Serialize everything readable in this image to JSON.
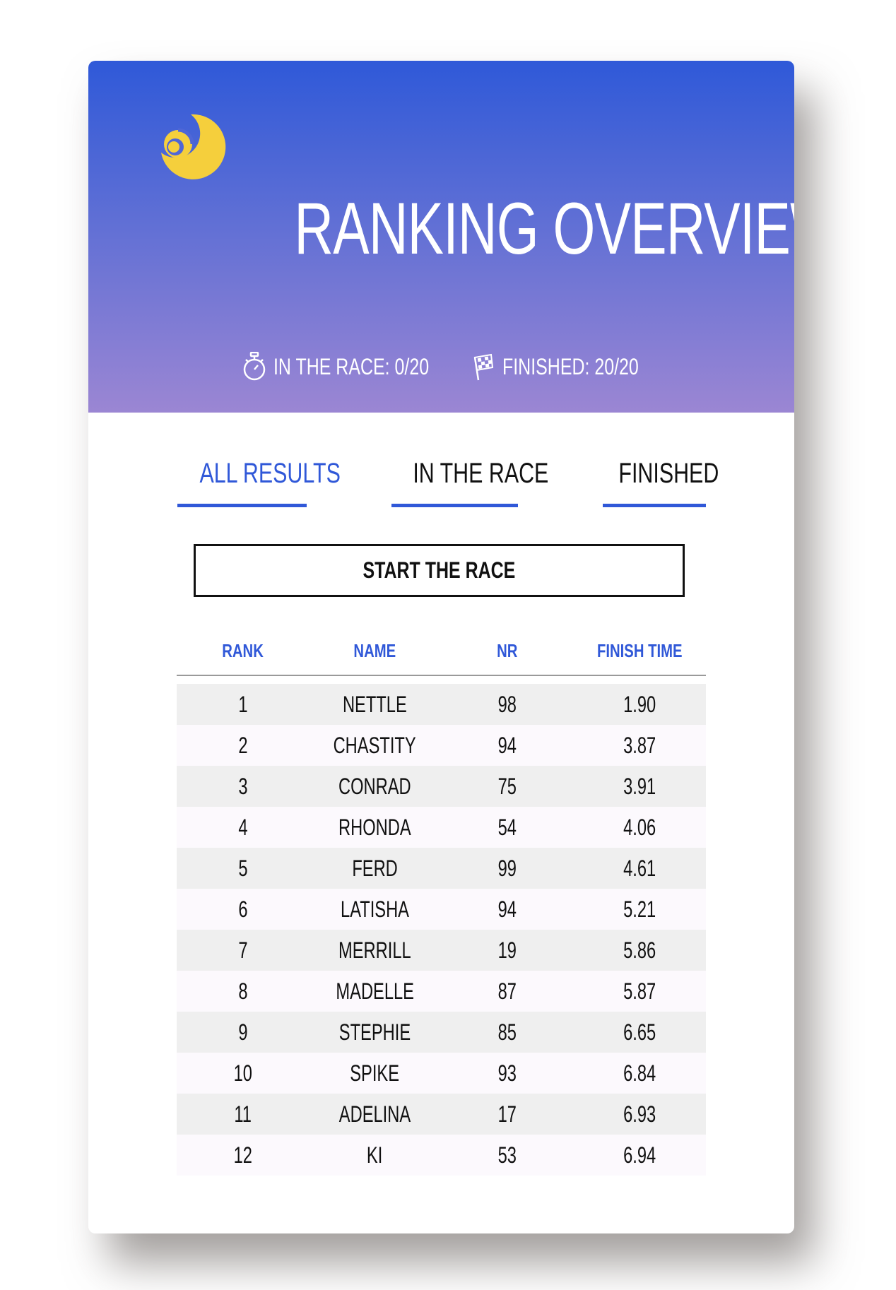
{
  "header": {
    "title": "RANKING OVERVIEW",
    "stats": {
      "in_race_label": "IN THE RACE:",
      "in_race_value": "0/20",
      "finished_label": "FINISHED:",
      "finished_value": "20/20"
    },
    "icons": {
      "logo": "moon-logo-icon",
      "in_race": "stopwatch-icon",
      "finished": "checkered-flag-icon"
    },
    "colors": {
      "gradient_top": "#2f59d8",
      "gradient_bottom": "#9b86d3",
      "logo": "#f5cf3c"
    }
  },
  "tabs": [
    {
      "label": "ALL RESULTS",
      "active": true
    },
    {
      "label": "IN THE RACE",
      "active": false
    },
    {
      "label": "FINISHED",
      "active": false
    }
  ],
  "start_button": {
    "label": "START THE RACE"
  },
  "table": {
    "columns": [
      "RANK",
      "NAME",
      "NR",
      "FINISH TIME"
    ],
    "rows": [
      [
        "1",
        "NETTLE",
        "98",
        "1.90"
      ],
      [
        "2",
        "CHASTITY",
        "94",
        "3.87"
      ],
      [
        "3",
        "CONRAD",
        "75",
        "3.91"
      ],
      [
        "4",
        "RHONDA",
        "54",
        "4.06"
      ],
      [
        "5",
        "FERD",
        "99",
        "4.61"
      ],
      [
        "6",
        "LATISHA",
        "94",
        "5.21"
      ],
      [
        "7",
        "MERRILL",
        "19",
        "5.86"
      ],
      [
        "8",
        "MADELLE",
        "87",
        "5.87"
      ],
      [
        "9",
        "STEPHIE",
        "85",
        "6.65"
      ],
      [
        "10",
        "SPIKE",
        "93",
        "6.84"
      ],
      [
        "11",
        "ADELINA",
        "17",
        "6.93"
      ],
      [
        "12",
        "KI",
        "53",
        "6.94"
      ]
    ]
  },
  "accent_color": "#3058d8"
}
